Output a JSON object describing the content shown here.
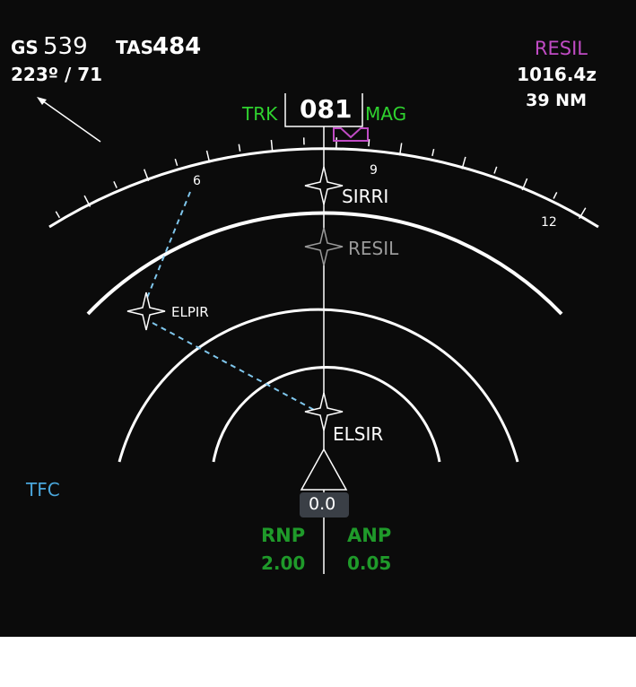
{
  "speed": {
    "gs_label": "GS",
    "gs_value": "539",
    "tas_label": "TAS",
    "tas_value": "484",
    "wind": "223º  /  71"
  },
  "track": {
    "trk_label": "TRK",
    "value": "081",
    "mag_label": "MAG"
  },
  "active_waypoint": {
    "name": "RESIL",
    "eta": "1016.4z",
    "distance": "39 NM"
  },
  "compass_labels": [
    "6",
    "9",
    "12"
  ],
  "waypoints": [
    {
      "name": "SIRRI",
      "color": "#ffffff"
    },
    {
      "name": "RESIL",
      "color": "#9a9a9a"
    },
    {
      "name": "ELPIR",
      "color": "#ffffff"
    },
    {
      "name": "ELSIR",
      "color": "#ffffff"
    }
  ],
  "tfc_label": "TFC",
  "aircraft_value": "0.0",
  "rnp": {
    "label": "RNP",
    "value": "2.00"
  },
  "anp": {
    "label": "ANP",
    "value": "0.05"
  },
  "colors": {
    "background": "#0b0b0b",
    "green": "#2fd22f",
    "dark_green": "#1f9a2a",
    "magenta": "#c04bc4",
    "cyan": "#4aa7dc"
  }
}
